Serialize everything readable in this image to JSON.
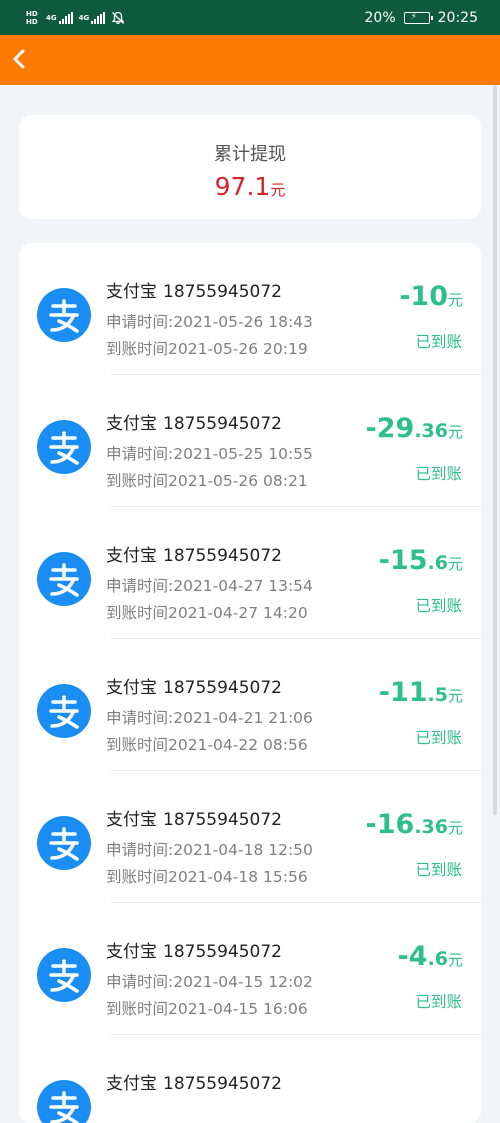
{
  "status_bar": {
    "network_tags": [
      "HD",
      "HD"
    ],
    "network_gen": [
      "4G",
      "4G"
    ],
    "battery": "20%",
    "time": "20:25"
  },
  "header": {
    "back_icon": "chevron-left-icon",
    "background_color": "#ff7a00"
  },
  "summary": {
    "label": "累计提现",
    "amount": "97.1",
    "unit": "元",
    "amount_color": "#d8232a"
  },
  "list": {
    "accent_color": "#2ebf8c",
    "items": [
      {
        "method": "支付宝",
        "account": "18755945072",
        "apply": "申请时间:2021-05-26 18:43",
        "arrive": "到账时间2021-05-26 20:19",
        "amount_int": "-10",
        "amount_dec": "",
        "unit": "元",
        "status": "已到账"
      },
      {
        "method": "支付宝",
        "account": "18755945072",
        "apply": "申请时间:2021-05-25 10:55",
        "arrive": "到账时间2021-05-26 08:21",
        "amount_int": "-29",
        "amount_dec": ".36",
        "unit": "元",
        "status": "已到账"
      },
      {
        "method": "支付宝",
        "account": "18755945072",
        "apply": "申请时间:2021-04-27 13:54",
        "arrive": "到账时间2021-04-27 14:20",
        "amount_int": "-15",
        "amount_dec": ".6",
        "unit": "元",
        "status": "已到账"
      },
      {
        "method": "支付宝",
        "account": "18755945072",
        "apply": "申请时间:2021-04-21 21:06",
        "arrive": "到账时间2021-04-22 08:56",
        "amount_int": "-11",
        "amount_dec": ".5",
        "unit": "元",
        "status": "已到账"
      },
      {
        "method": "支付宝",
        "account": "18755945072",
        "apply": "申请时间:2021-04-18 12:50",
        "arrive": "到账时间2021-04-18 15:56",
        "amount_int": "-16",
        "amount_dec": ".36",
        "unit": "元",
        "status": "已到账"
      },
      {
        "method": "支付宝",
        "account": "18755945072",
        "apply": "申请时间:2021-04-15 12:02",
        "arrive": "到账时间2021-04-15 16:06",
        "amount_int": "-4",
        "amount_dec": ".6",
        "unit": "元",
        "status": "已到账"
      },
      {
        "method": "支付宝",
        "account": "18755945072",
        "apply": "",
        "arrive": "",
        "amount_int": "",
        "amount_dec": "",
        "unit": "",
        "status": ""
      }
    ]
  }
}
